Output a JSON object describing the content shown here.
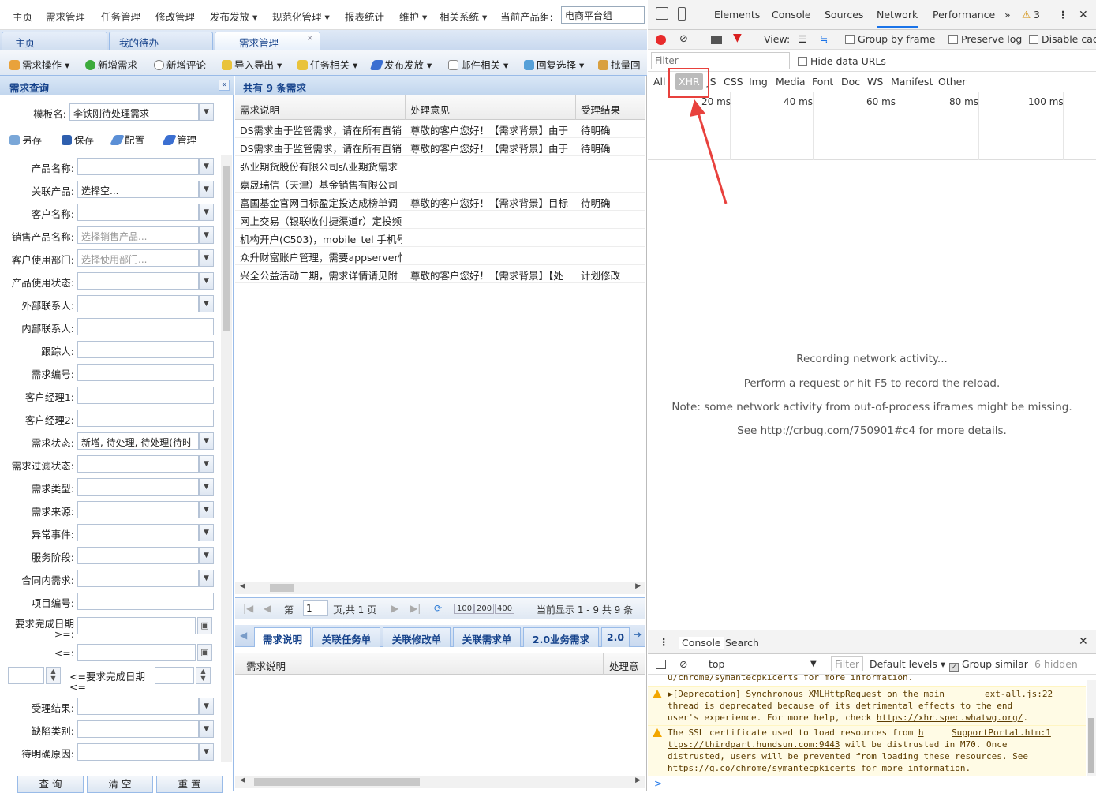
{
  "app": {
    "menu": {
      "items": [
        "主页",
        "需求管理",
        "任务管理",
        "修改管理",
        "发布发放 ▾",
        "规范化管理 ▾",
        "报表统计",
        "维护 ▾",
        "相关系统 ▾",
        "当前产品组:"
      ],
      "product_group": "电商平台组"
    },
    "tabs": [
      {
        "label": "主页"
      },
      {
        "label": "我的待办"
      },
      {
        "label": "需求管理",
        "close": "×"
      }
    ],
    "toolbar": [
      "需求操作 ▾",
      "新增需求",
      "新增评论",
      "导入导出 ▾",
      "任务相关 ▾",
      "发布发放 ▾",
      "邮件相关 ▾",
      "回复选择 ▾",
      "批量回"
    ],
    "query": {
      "title": "需求查询",
      "collapse": "«",
      "template_label": "模板名:",
      "template_value": "李铁刚待处理需求",
      "actions": [
        "另存",
        "保存",
        "配置",
        "管理"
      ],
      "fields": [
        {
          "label": "产品名称:",
          "value": "",
          "dropdown": true
        },
        {
          "label": "关联产品:",
          "value": "选择空...",
          "dropdown": true
        },
        {
          "label": "客户名称:",
          "value": "",
          "dropdown": true
        },
        {
          "label": "销售产品名称:",
          "value": "选择销售产品...",
          "dropdown": true,
          "placeholder": true
        },
        {
          "label": "客户使用部门:",
          "value": "选择使用部门...",
          "dropdown": true,
          "placeholder": true
        },
        {
          "label": "产品使用状态:",
          "value": "",
          "dropdown": true
        },
        {
          "label": "外部联系人:",
          "value": "",
          "dropdown": true
        },
        {
          "label": "内部联系人:",
          "value": "",
          "dropdown": false
        },
        {
          "label": "跟踪人:",
          "value": "",
          "dropdown": false
        },
        {
          "label": "需求编号:",
          "value": "",
          "dropdown": false
        },
        {
          "label": "客户经理1:",
          "value": "",
          "dropdown": false
        },
        {
          "label": "客户经理2:",
          "value": "",
          "dropdown": false
        },
        {
          "label": "需求状态:",
          "value": "新增, 待处理, 待处理(待时",
          "dropdown": true
        },
        {
          "label": "需求过滤状态:",
          "value": "",
          "dropdown": true
        },
        {
          "label": "需求类型:",
          "value": "",
          "dropdown": true
        },
        {
          "label": "需求来源:",
          "value": "",
          "dropdown": true
        },
        {
          "label": "异常事件:",
          "value": "",
          "dropdown": true
        },
        {
          "label": "服务阶段:",
          "value": "",
          "dropdown": true
        },
        {
          "label": "合同内需求:",
          "value": "",
          "dropdown": true
        },
        {
          "label": "项目编号:",
          "value": "",
          "dropdown": false
        }
      ],
      "due_label_1": "要求完成日期",
      "due_label_2": ">=:",
      "due_label_3": "<=:",
      "due_between": "<=要求完成日期",
      "due_between_2": "<=",
      "fields2": [
        {
          "label": "受理结果:",
          "value": ""
        },
        {
          "label": "缺陷类别:",
          "value": ""
        },
        {
          "label": "待明确原因:",
          "value": ""
        }
      ],
      "buttons": [
        "查 询",
        "清 空",
        "重 置"
      ]
    },
    "grid": {
      "title": "共有 9 条需求",
      "columns": [
        "需求说明",
        "处理意见",
        "受理结果"
      ],
      "rows": [
        [
          "DS需求由于监管需求，请在所有直销",
          "尊敬的客户您好！【需求背景】由于",
          "待明确"
        ],
        [
          "DS需求由于监管需求，请在所有直销",
          "尊敬的客户您好！【需求背景】由于",
          "待明确"
        ],
        [
          "弘业期货股份有限公司弘业期货需求",
          "",
          ""
        ],
        [
          "嘉晟瑞信（天津）基金销售有限公司",
          "",
          ""
        ],
        [
          "富国基金官网目标盈定投达成榜单调",
          "尊敬的客户您好！【需求背景】目标",
          "待明确"
        ],
        [
          "网上交易（银联收付捷渠道r）定投频",
          "",
          ""
        ],
        [
          "机构开户(C503)，mobile_tel 手机号",
          "",
          ""
        ],
        [
          "众升财富账户管理，需要appserver恒",
          "",
          ""
        ],
        [
          "兴全公益活动二期，需求详情请见附",
          "尊敬的客户您好！【需求背景】【处",
          "计划修改"
        ]
      ],
      "pager": {
        "page_prefix": "第",
        "page": "1",
        "page_suffix": "页,共 1 页",
        "sizes": [
          "100",
          "200",
          "400"
        ],
        "summary": "当前显示 1 - 9 共 9 条"
      }
    },
    "detail": {
      "tabs": [
        "需求说明",
        "关联任务单",
        "关联修改单",
        "关联需求单",
        "2.0业务需求",
        "2.0"
      ],
      "columns": [
        "需求说明",
        "处理意"
      ]
    }
  },
  "devtools": {
    "tabs": [
      "Elements",
      "Console",
      "Sources",
      "Network",
      "Performance",
      "»"
    ],
    "warn_count": "3",
    "netbar": {
      "view": "View:",
      "group": "Group by frame",
      "preserve": "Preserve log",
      "disable": "Disable cac"
    },
    "filter_placeholder": "Filter",
    "hide_data_urls": "Hide data URLs",
    "types": [
      "All",
      "XHR",
      "JS",
      "CSS",
      "Img",
      "Media",
      "Font",
      "Doc",
      "WS",
      "Manifest",
      "Other"
    ],
    "timeline_ticks": [
      "20 ms",
      "40 ms",
      "60 ms",
      "80 ms",
      "100 ms"
    ],
    "messages": [
      "Recording network activity...",
      "Perform a request or hit F5 to record the reload.",
      "Note: some network activity from out-of-process iframes might be missing.",
      "See http://crbug.com/750901#c4 for more details."
    ],
    "drawer": {
      "tabs": [
        "Console",
        "Search"
      ],
      "context": "top",
      "filter": "Filter",
      "levels": "Default levels ▾",
      "group_similar": "Group similar",
      "hidden": "6 hidden",
      "clipped_line": "u/chrome/symantecpkicerts for more information.",
      "warn1_text": "▶[Deprecation] Synchronous XMLHttpRequest on the main",
      "warn1_link": "ext-all.js:22",
      "warn1_l2": "thread is deprecated because of its detrimental effects to the end",
      "warn1_l3": "user's experience. For more help, check",
      "warn1_url": "https://xhr.spec.whatwg.org/",
      "warn2_text": "The SSL certificate used to load resources from",
      "warn2_h": "h",
      "warn2_link": "SupportPortal.htm:1",
      "warn2_l2a": "ttps://thirdpart.hundsun.com:9443",
      "warn2_l2b": " will be distrusted in M70. Once",
      "warn2_l3": "distrusted, users will be prevented from loading these resources. See",
      "warn2_url": "https://g.co/chrome/symantecpkicerts",
      "warn2_l4b": " for more information.",
      "prompt": ">"
    }
  },
  "colors": {
    "accent": "#15428b",
    "annotation": "#e8413d",
    "panel": "#dae7f6"
  }
}
